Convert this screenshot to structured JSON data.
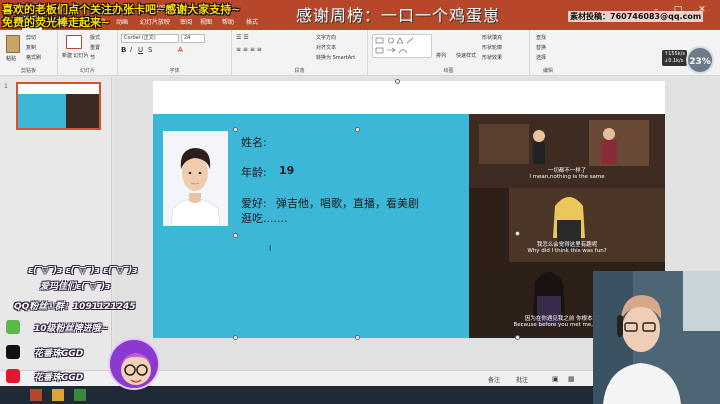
{
  "window": {
    "title": "操作说明搜索"
  },
  "ribbon_tabs": [
    "文件",
    "开始",
    "插入",
    "设计",
    "切换",
    "动画",
    "幻灯片放映",
    "审阅",
    "视图",
    "帮助",
    "格式"
  ],
  "ribbon": {
    "clipboard": {
      "paste": "粘贴",
      "cut": "剪切",
      "copy": "复制",
      "format_painter": "格式刷",
      "label": "剪贴板"
    },
    "slides": {
      "new_slide": "新建\n幻灯片",
      "layout": "版式",
      "reset": "重置",
      "section": "节",
      "label": "幻灯片"
    },
    "font": {
      "name": "Corbel (正文)",
      "size": "24",
      "label": "字体"
    },
    "paragraph": {
      "text_direction": "文字方向",
      "align_text": "对齐文本",
      "smartart": "转换为 SmartArt",
      "label": "段落"
    },
    "drawing": {
      "arrange": "排列",
      "quick_styles": "快速样式",
      "shape_fill": "形状填充",
      "shape_outline": "形状轮廓",
      "shape_effects": "形状效果",
      "label": "绘图"
    },
    "editing": {
      "find": "查找",
      "replace": "替换",
      "select": "选择",
      "label": "编辑"
    }
  },
  "slide_panel": {
    "slide_number": "1"
  },
  "slide": {
    "name_label": "姓名:",
    "age_label": "年龄:",
    "age_value": "19",
    "hobby_label": "爱好:",
    "hobby_line1": "弹吉他，唱歌，直播，看美剧",
    "hobby_line2": "逛吃.......",
    "subtitles": [
      {
        "cn": "一切都不一样了",
        "en": "I mean,nothing is the same"
      },
      {
        "cn": "我怎么会觉得这里有趣呢",
        "en": "Why did I think this was fun?"
      },
      {
        "cn": "因为在你遇见我之前 你根本不知道",
        "en": "Because before you met me,you didn't"
      }
    ]
  },
  "statusbar": {
    "notes": "备注",
    "comments": "批注"
  },
  "overlay": {
    "banner_line1": "喜欢的老板们点个关注办张卡吧~感谢大家支持~",
    "banner_line2": "免费的荧光棒走起来~",
    "stream_title": "感谢周榜：一口一个鸡蛋崽",
    "contact": "素材投稿：760746083@qq.com",
    "fps_badge": "23%",
    "ping_lines": [
      "↑155k/s",
      "↓0.1k/s"
    ],
    "promo": [
      "ε(‾▽‾)з ε(‾▽‾)з ε(‾▽‾)з",
      "爱玛佳们ε(‾▽‾)з",
      "QQ粉丝①群：1091121245",
      "10级粉丝牌进哦~",
      "花番珠GGD",
      "花番珠GGD"
    ]
  },
  "colors": {
    "ppt_red": "#b7472a",
    "slide_blue": "#3db7d8",
    "banner_yellow": "#ffe100"
  }
}
